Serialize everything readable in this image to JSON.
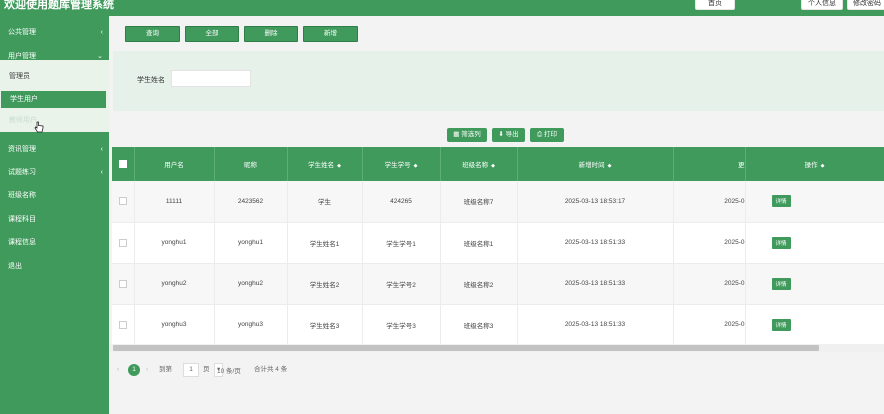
{
  "app": {
    "title": "欢迎使用题库管理系统"
  },
  "topbar": {
    "buttons": [
      "首页",
      "个人信息",
      "修改密码"
    ]
  },
  "sidebar": {
    "items": [
      {
        "label": "公共管理",
        "chevron": "‹"
      },
      {
        "label": "用户管理",
        "chevron": "⌄"
      },
      {
        "label": "资讯管理",
        "chevron": "‹"
      },
      {
        "label": "试题练习",
        "chevron": "‹"
      },
      {
        "label": "班级名称"
      },
      {
        "label": "课程科目"
      },
      {
        "label": "课程信息"
      },
      {
        "label": "退出"
      }
    ],
    "sub_items": [
      {
        "label": "管理员"
      },
      {
        "label": "学生用户"
      },
      {
        "label": "教师用户"
      }
    ]
  },
  "actions": [
    "查询",
    "全部",
    "删除",
    "新增"
  ],
  "filter": {
    "label": "学生姓名",
    "value": ""
  },
  "tools": [
    {
      "icon": "▦",
      "label": "筛选列"
    },
    {
      "icon": "⬇",
      "label": "导出"
    },
    {
      "icon": "⎙",
      "label": "打印"
    }
  ],
  "table": {
    "columns": [
      "用户名",
      "昵称",
      "学生姓名",
      "学生学号",
      "班级名称",
      "新增时间",
      "更",
      "操作"
    ],
    "sortable": [
      false,
      false,
      true,
      true,
      true,
      true,
      false,
      true
    ],
    "rows": [
      [
        "11111",
        "2423562",
        "学生",
        "424265",
        "班级名称7",
        "2025-03-13 18:53:17",
        "2025-0",
        "详情"
      ],
      [
        "yonghu1",
        "yonghu1",
        "学生姓名1",
        "学生学号1",
        "班级名称1",
        "2025-03-13 18:51:33",
        "2025-0",
        "详情"
      ],
      [
        "yonghu2",
        "yonghu2",
        "学生姓名2",
        "学生学号2",
        "班级名称2",
        "2025-03-13 18:51:33",
        "2025-0",
        "详情"
      ],
      [
        "yonghu3",
        "yonghu3",
        "学生姓名3",
        "学生学号3",
        "班级名称3",
        "2025-03-13 18:51:33",
        "2025-0",
        "详情"
      ]
    ]
  },
  "pagination": {
    "prev": "‹",
    "current": "1",
    "next": "›",
    "jump_label": "到第",
    "jump_value": "1",
    "page_unit": "页",
    "page_size": "10 条/页",
    "total": "合计共 4 条"
  },
  "colors": {
    "primary": "#3f9a5c",
    "sub_bg": "#e9f3ea"
  }
}
